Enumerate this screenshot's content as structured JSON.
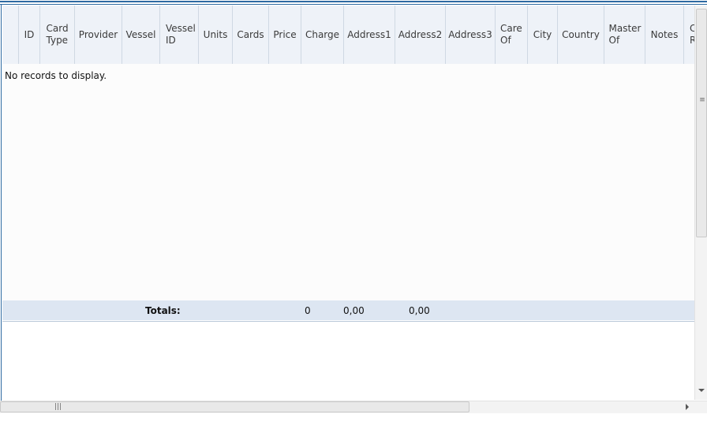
{
  "columns": [
    {
      "label": ""
    },
    {
      "label": "ID"
    },
    {
      "label": "Card Type"
    },
    {
      "label": "Provider"
    },
    {
      "label": "Vessel"
    },
    {
      "label": "Vessel ID"
    },
    {
      "label": "Units"
    },
    {
      "label": "Cards"
    },
    {
      "label": "Price"
    },
    {
      "label": "Charge"
    },
    {
      "label": "Address1"
    },
    {
      "label": "Address2"
    },
    {
      "label": "Address3"
    },
    {
      "label": "Care Of"
    },
    {
      "label": "City"
    },
    {
      "label": "Country"
    },
    {
      "label": "Master Of"
    },
    {
      "label": "Notes"
    },
    {
      "label": "C R"
    }
  ],
  "empty_message": "No records to display.",
  "totals": {
    "label": "Totals:",
    "cards": "0",
    "price": "0,00",
    "address1": "0,00"
  },
  "scrollbar": {
    "v_grip": "≡",
    "h_grip": "|||"
  },
  "colors": {
    "frame_border": "#2e6aa2",
    "header_bg": "#eef2f8",
    "totals_bg": "#dde6f2"
  }
}
